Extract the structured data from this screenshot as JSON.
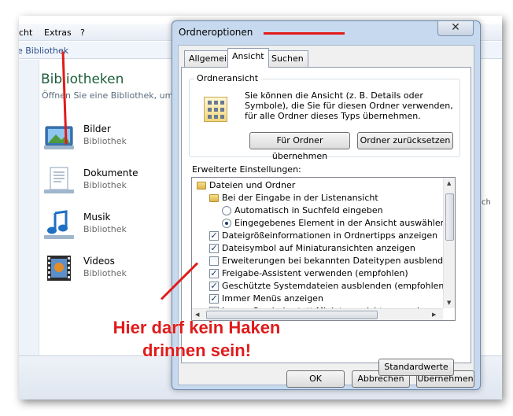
{
  "explorer": {
    "menu": [
      "cht",
      "Extras",
      "?"
    ],
    "address": "e Bibliothek",
    "title": "Bibliotheken",
    "subtitle": "Öffnen Sie eine Bibliothek, um",
    "libraries": [
      {
        "name": "Bilder",
        "type": "Bibliothek",
        "icon": "pictures-library-icon"
      },
      {
        "name": "Dokumente",
        "type": "Bibliothek",
        "icon": "documents-library-icon"
      },
      {
        "name": "Musik",
        "type": "Bibliothek",
        "icon": "music-library-icon"
      },
      {
        "name": "Videos",
        "type": "Bibliothek",
        "icon": "videos-library-icon"
      }
    ],
    "right_fragment": "ch"
  },
  "dialog": {
    "title": "Ordneroptionen",
    "close": "✕",
    "tabs": [
      "Allgemein",
      "Ansicht",
      "Suchen"
    ],
    "active_tab": "Ansicht",
    "view_group": {
      "label": "Ordneransicht",
      "text": "Sie können die Ansicht (z. B. Details oder Symbole), die Sie für diesen Ordner verwenden, für alle Ordner dieses Typs übernehmen.",
      "apply_button": "Für Ordner übernehmen",
      "reset_button": "Ordner zurücksetzen"
    },
    "advanced_label": "Erweiterte Einstellungen:",
    "settings": [
      {
        "kind": "folder",
        "indent": 0,
        "label": "Dateien und Ordner"
      },
      {
        "kind": "folder",
        "indent": 1,
        "label": "Bei der Eingabe in der Listenansicht"
      },
      {
        "kind": "radio",
        "indent": 2,
        "checked": false,
        "label": "Automatisch in Suchfeld eingeben"
      },
      {
        "kind": "radio",
        "indent": 2,
        "checked": true,
        "label": "Eingegebenes Element in der Ansicht auswählen"
      },
      {
        "kind": "checkbox",
        "indent": 1,
        "checked": true,
        "label": "Dateigrößeinformationen in Ordnertipps anzeigen"
      },
      {
        "kind": "checkbox",
        "indent": 1,
        "checked": true,
        "label": "Dateisymbol auf Miniaturansichten anzeigen"
      },
      {
        "kind": "checkbox",
        "indent": 1,
        "checked": false,
        "label": "Erweiterungen bei bekannten Dateitypen ausblenden"
      },
      {
        "kind": "checkbox",
        "indent": 1,
        "checked": true,
        "label": "Freigabe-Assistent verwenden (empfohlen)"
      },
      {
        "kind": "checkbox",
        "indent": 1,
        "checked": true,
        "label": "Geschützte Systemdateien ausblenden (empfohlen)"
      },
      {
        "kind": "checkbox",
        "indent": 1,
        "checked": true,
        "label": "Immer Menüs anzeigen"
      },
      {
        "kind": "checkbox",
        "indent": 1,
        "checked": false,
        "label": "Immer Symbole statt Miniaturansichten anzeigen"
      }
    ],
    "defaults_button": "Standardwerte",
    "ok_button": "OK",
    "cancel_button": "Abbrechen",
    "apply_button": "Übernehmen"
  },
  "annotation": {
    "line1": "Hier darf kein Haken",
    "line2": "drinnen sein!",
    "color": "#e11b1b"
  }
}
